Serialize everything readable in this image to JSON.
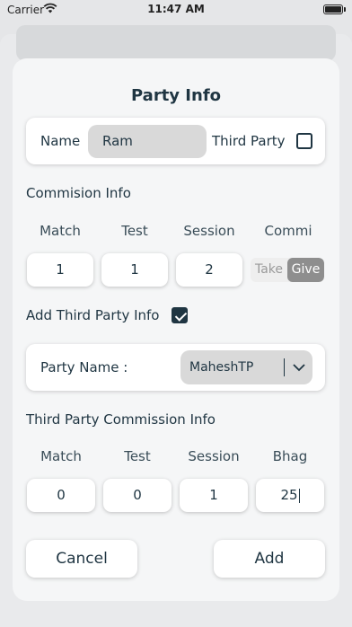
{
  "status": {
    "carrier": "Carrier",
    "time": "11:47 AM"
  },
  "title": "Party Info",
  "name_row": {
    "label": "Name",
    "value": "Ram",
    "third_party_label": "Third Party",
    "third_party_checked": false
  },
  "commission": {
    "section_label": "Commision Info",
    "columns": [
      "Match",
      "Test",
      "Session",
      "Commi"
    ],
    "values": [
      "1",
      "1",
      "2"
    ],
    "toggle": {
      "take": "Take",
      "give": "Give",
      "selected": "Give"
    }
  },
  "add_third_party": {
    "label": "Add Third Party Info",
    "checked": true
  },
  "party_name": {
    "label": "Party Name :",
    "value": "MaheshTP"
  },
  "third_party_commission": {
    "section_label": "Third Party Commission Info",
    "columns": [
      "Match",
      "Test",
      "Session",
      "Bhag"
    ],
    "values": [
      "0",
      "0",
      "1",
      "25"
    ]
  },
  "actions": {
    "cancel": "Cancel",
    "add": "Add"
  },
  "colors": {
    "text": "#1f3542",
    "card": "#f5f6f7",
    "field_gray": "#d9d9d9",
    "toggle_selected": "#8e8e8e"
  }
}
